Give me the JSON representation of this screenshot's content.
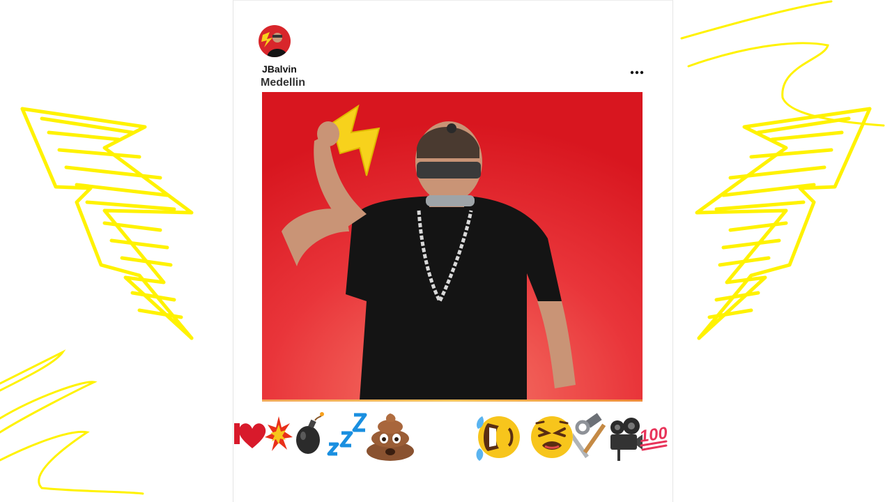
{
  "post": {
    "username": "JBalvin",
    "location": "Medellin",
    "more_label": "•••"
  },
  "colors": {
    "scribble": "#fff200",
    "photo_background": "#e0262b",
    "shirt": "#141414",
    "bolt": "#f7d21c"
  },
  "icons": {
    "avatar": "avatar-photo",
    "more": "more-options-icon",
    "reactions": [
      "heart-icon",
      "explosion-icon",
      "bomb-icon",
      "zzz-icon",
      "poop-icon",
      "laughing-tears-icon",
      "tired-face-icon",
      "hammer-wrench-icon",
      "film-camera-icon",
      "hundred-points-icon"
    ]
  },
  "reaction_labels": {
    "hundred": "100"
  }
}
